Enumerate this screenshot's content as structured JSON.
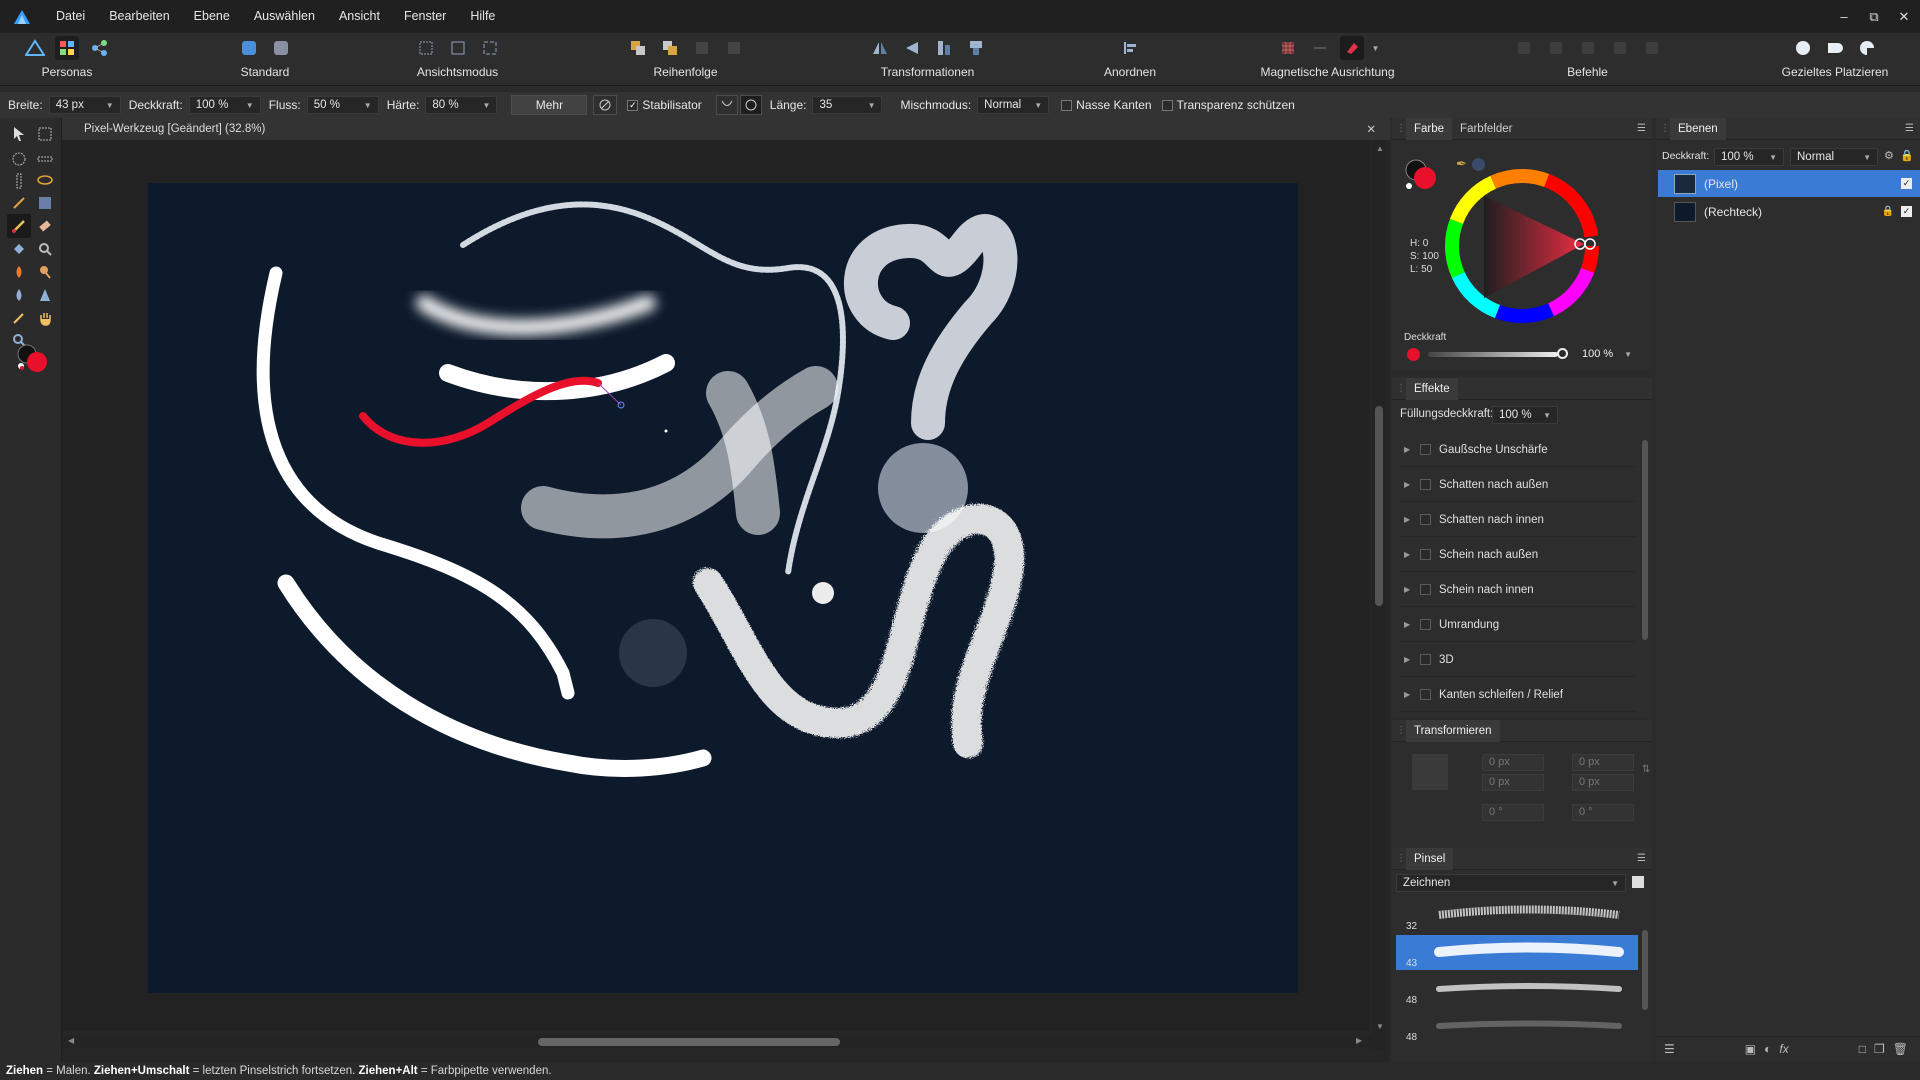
{
  "menu": {
    "items": [
      "Datei",
      "Bearbeiten",
      "Ebene",
      "Auswählen",
      "Ansicht",
      "Fenster",
      "Hilfe"
    ]
  },
  "toolbar": {
    "groups": {
      "personas": "Personas",
      "standard": "Standard",
      "ansichtsmodus": "Ansichtsmodus",
      "reihenfolge": "Reihenfolge",
      "transformationen": "Transformationen",
      "anordnen": "Anordnen",
      "magnetische": "Magnetische Ausrichtung",
      "befehle": "Befehle",
      "gezieltes": "Gezieltes Platzieren"
    }
  },
  "context": {
    "breite_label": "Breite:",
    "breite_value": "43 px",
    "deckkraft_label": "Deckkraft:",
    "deckkraft_value": "100 %",
    "fluss_label": "Fluss:",
    "fluss_value": "50 %",
    "haerte_label": "Härte:",
    "haerte_value": "80 %",
    "mehr_label": "Mehr",
    "stabilisator_label": "Stabilisator",
    "stabilisator_checked": true,
    "laenge_label": "Länge:",
    "laenge_value": "35",
    "mischmodus_label": "Mischmodus:",
    "mischmodus_value": "Normal",
    "nasse_kanten_label": "Nasse Kanten",
    "transparenz_label": "Transparenz schützen"
  },
  "document": {
    "title": "Pixel-Werkzeug [Geändert] (32.8%)"
  },
  "color_panel": {
    "tab_farbe": "Farbe",
    "tab_farbfelder": "Farbfelder",
    "h": "H: 0",
    "s": "S: 100",
    "l": "L: 50",
    "deckkraft_label": "Deckkraft",
    "deckkraft_value": "100 %",
    "primary_color": "#e8102a",
    "secondary_color": "#000000"
  },
  "effects_panel": {
    "tab": "Effekte",
    "fill_opacity_label": "Füllungsdeckkraft:",
    "fill_opacity_value": "100 %",
    "items": [
      "Gaußsche Unschärfe",
      "Schatten nach außen",
      "Schatten nach innen",
      "Schein nach außen",
      "Schein nach innen",
      "Umrandung",
      "3D",
      "Kanten schleifen / Relief"
    ]
  },
  "transform_panel": {
    "tab": "Transformieren",
    "x": "0 px",
    "y": "0 px",
    "w": "0 px",
    "h": "0 px",
    "r": "0 °",
    "s": "0 °"
  },
  "brush_panel": {
    "tab": "Pinsel",
    "category": "Zeichnen",
    "brushes": [
      {
        "size": "32"
      },
      {
        "size": "43"
      },
      {
        "size": "48"
      },
      {
        "size": "48"
      }
    ]
  },
  "layers_panel": {
    "tab": "Ebenen",
    "deckkraft_label": "Deckkraft:",
    "deckkraft_value": "100 %",
    "blend_value": "Normal",
    "layers": [
      {
        "name": "(Pixel)",
        "selected": true
      },
      {
        "name": "(Rechteck)",
        "selected": false
      }
    ]
  },
  "status": {
    "k1": "Ziehen",
    "t1": " = Malen. ",
    "k2": "Ziehen+Umschalt",
    "t2": " = letzten Pinselstrich fortsetzen. ",
    "k3": "Ziehen+Alt",
    "t3": " = Farbpipette verwenden."
  }
}
